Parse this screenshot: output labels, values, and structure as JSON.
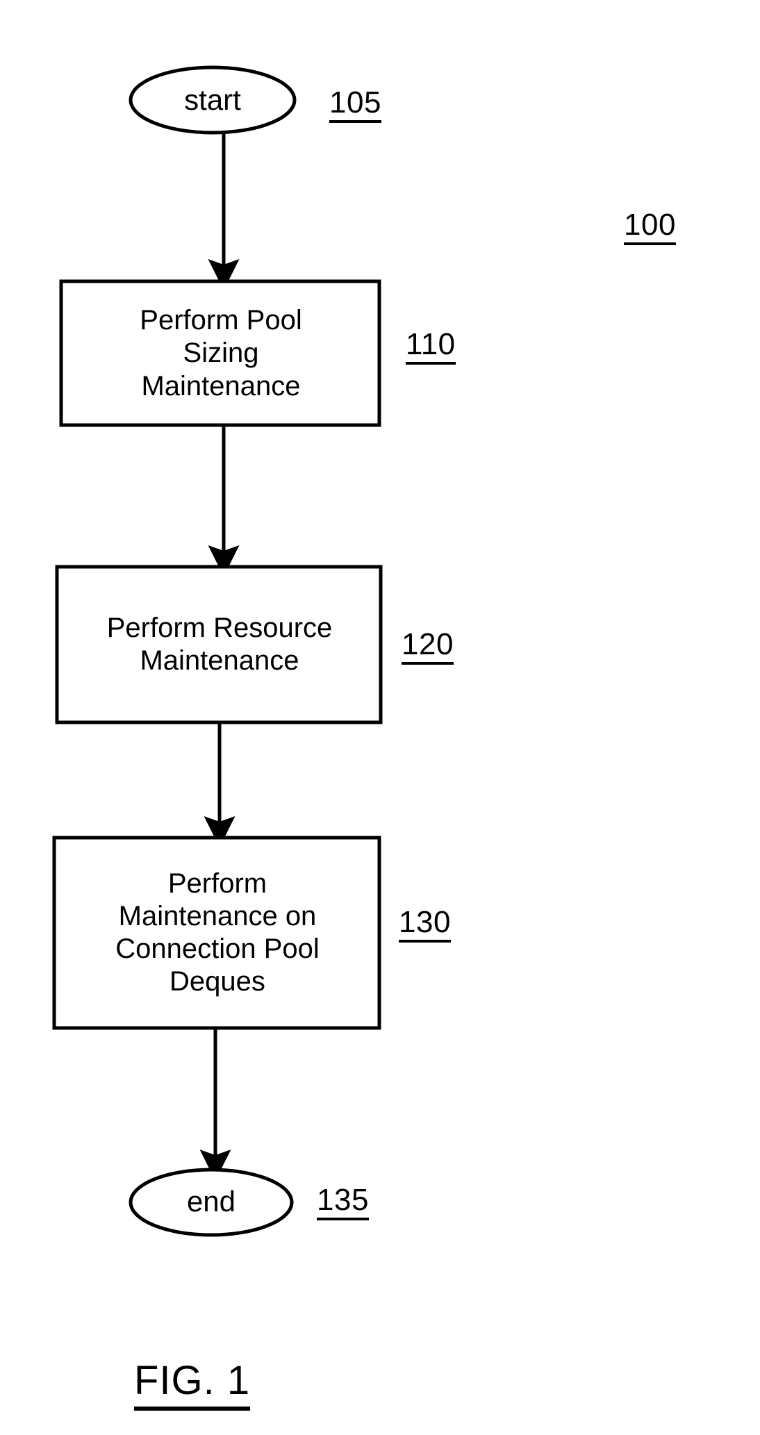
{
  "figure": {
    "caption": "FIG. 1",
    "overall_ref": "100"
  },
  "nodes": [
    {
      "id": "start",
      "shape": "ellipse",
      "label": "start",
      "ref": "105"
    },
    {
      "id": "pool-sizing-maintenance",
      "shape": "rectangle",
      "label": "Perform Pool\nSizing\nMaintenance",
      "ref": "110"
    },
    {
      "id": "resource-maintenance",
      "shape": "rectangle",
      "label": "Perform Resource\nMaintenance",
      "ref": "120"
    },
    {
      "id": "connection-pool-deques-maintenance",
      "shape": "rectangle",
      "label": "Perform\nMaintenance on\nConnection Pool\nDeques",
      "ref": "130"
    },
    {
      "id": "end",
      "shape": "ellipse",
      "label": "end",
      "ref": "135"
    }
  ],
  "edges": [
    {
      "from": "start",
      "to": "pool-sizing-maintenance",
      "style": "arrow"
    },
    {
      "from": "pool-sizing-maintenance",
      "to": "resource-maintenance",
      "style": "arrow"
    },
    {
      "from": "resource-maintenance",
      "to": "connection-pool-deques-maintenance",
      "style": "arrow"
    },
    {
      "from": "connection-pool-deques-maintenance",
      "to": "end",
      "style": "arrow"
    }
  ],
  "colors": {
    "stroke": "#000000",
    "fill": "#ffffff",
    "background": "#ffffff"
  }
}
